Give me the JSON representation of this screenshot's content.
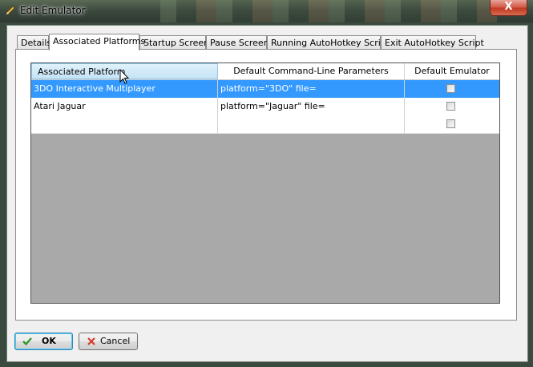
{
  "window": {
    "title": "Edit Emulator",
    "close_glyph": "X"
  },
  "tabs": [
    {
      "label": "Details"
    },
    {
      "label": "Associated Platforms"
    },
    {
      "label": "Startup Screen"
    },
    {
      "label": "Pause Screen"
    },
    {
      "label": "Running AutoHotkey Script"
    },
    {
      "label": "Exit AutoHotkey Script"
    }
  ],
  "active_tab": "Associated Platforms",
  "table": {
    "columns": [
      "Associated Platform",
      "Default Command-Line Parameters",
      "Default Emulator"
    ],
    "rows": [
      {
        "platform": "3DO Interactive Multiplayer",
        "params": "platform=\"3DO\" file=",
        "default": false,
        "selected": true
      },
      {
        "platform": "Atari Jaguar",
        "params": "platform=\"Jaguar\" file=",
        "default": false,
        "selected": false
      },
      {
        "platform": "",
        "params": "",
        "default": false,
        "selected": false
      }
    ]
  },
  "buttons": {
    "ok": "OK",
    "cancel": "Cancel"
  },
  "icons": {
    "title": "pencil-icon",
    "ok": "checkmark-icon",
    "cancel": "x-icon"
  },
  "colors": {
    "selection": "#3399ff",
    "ok_check": "#2f9a2f",
    "cancel_x": "#d83a2a"
  }
}
